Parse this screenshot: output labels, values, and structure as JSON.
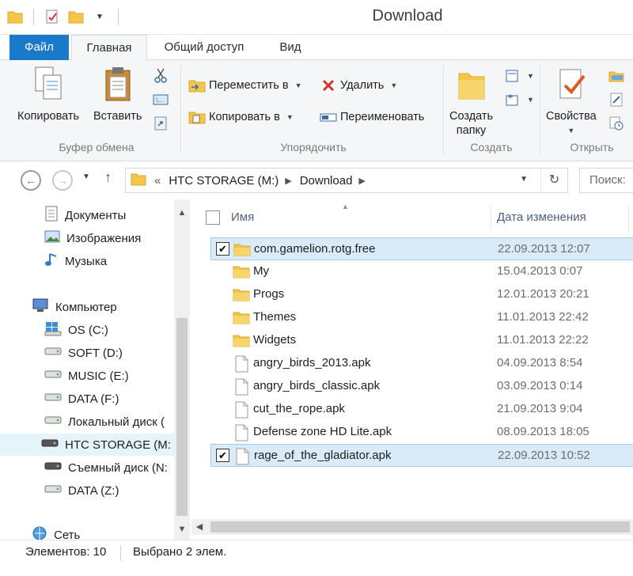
{
  "window": {
    "title": "Download"
  },
  "ribbon_tabs": {
    "file": "Файл",
    "home": "Главная",
    "share": "Общий доступ",
    "view": "Вид"
  },
  "ribbon": {
    "clipboard": {
      "copy": "Копировать",
      "paste": "Вставить",
      "label": "Буфер обмена"
    },
    "organize": {
      "move_to": "Переместить в",
      "copy_to": "Копировать в",
      "delete": "Удалить",
      "rename": "Переименовать",
      "label": "Упорядочить"
    },
    "create": {
      "new_folder_line1": "Создать",
      "new_folder_line2": "папку",
      "label": "Создать"
    },
    "open": {
      "properties": "Свойства",
      "label": "Открыть"
    }
  },
  "address": {
    "overflow": "«",
    "crumbs": [
      "HTC STORAGE (M:)",
      "Download"
    ],
    "search_placeholder": "Поиск:"
  },
  "nav": {
    "items": [
      {
        "label": "Документы",
        "icon": "documents-icon"
      },
      {
        "label": "Изображения",
        "icon": "pictures-icon"
      },
      {
        "label": "Музыка",
        "icon": "music-icon"
      },
      {
        "label": "Компьютер",
        "icon": "computer-icon"
      },
      {
        "label": "OS (C:)",
        "icon": "windows-drive-icon"
      },
      {
        "label": "SOFT (D:)",
        "icon": "drive-icon"
      },
      {
        "label": "MUSIC (E:)",
        "icon": "drive-icon"
      },
      {
        "label": "DATA (F:)",
        "icon": "drive-icon"
      },
      {
        "label": "Локальный диск (",
        "icon": "drive-icon"
      },
      {
        "label": "HTC STORAGE (M:",
        "icon": "removable-drive-icon",
        "selected": true
      },
      {
        "label": "Съемный диск (N:",
        "icon": "removable-drive-icon"
      },
      {
        "label": "DATA (Z:)",
        "icon": "drive-icon"
      },
      {
        "label": "Сеть",
        "icon": "network-icon"
      }
    ]
  },
  "columns": {
    "name": "Имя",
    "date": "Дата изменения"
  },
  "files": [
    {
      "name": "com.gamelion.rotg.free",
      "date": "22.09.2013 12:07",
      "type": "folder",
      "checked": true
    },
    {
      "name": "My",
      "date": "15.04.2013 0:07",
      "type": "folder",
      "checked": false
    },
    {
      "name": "Progs",
      "date": "12.01.2013 20:21",
      "type": "folder",
      "checked": false
    },
    {
      "name": "Themes",
      "date": "11.01.2013 22:42",
      "type": "folder",
      "checked": false
    },
    {
      "name": "Widgets",
      "date": "11.01.2013 22:22",
      "type": "folder",
      "checked": false
    },
    {
      "name": "angry_birds_2013.apk",
      "date": "04.09.2013 8:54",
      "type": "file",
      "checked": false
    },
    {
      "name": "angry_birds_classic.apk",
      "date": "03.09.2013 0:14",
      "type": "file",
      "checked": false
    },
    {
      "name": "cut_the_rope.apk",
      "date": "21.09.2013 9:04",
      "type": "file",
      "checked": false
    },
    {
      "name": "Defense zone HD Lite.apk",
      "date": "08.09.2013 18:05",
      "type": "file",
      "checked": false
    },
    {
      "name": "rage_of_the_gladiator.apk",
      "date": "22.09.2013 10:52",
      "type": "file",
      "checked": true
    }
  ],
  "status": {
    "items_count": "Элементов: 10",
    "selected": "Выбрано 2 элем."
  },
  "colors": {
    "accent": "#1979ca",
    "selection": "#d9ebf9",
    "folder": "#f3c548"
  }
}
